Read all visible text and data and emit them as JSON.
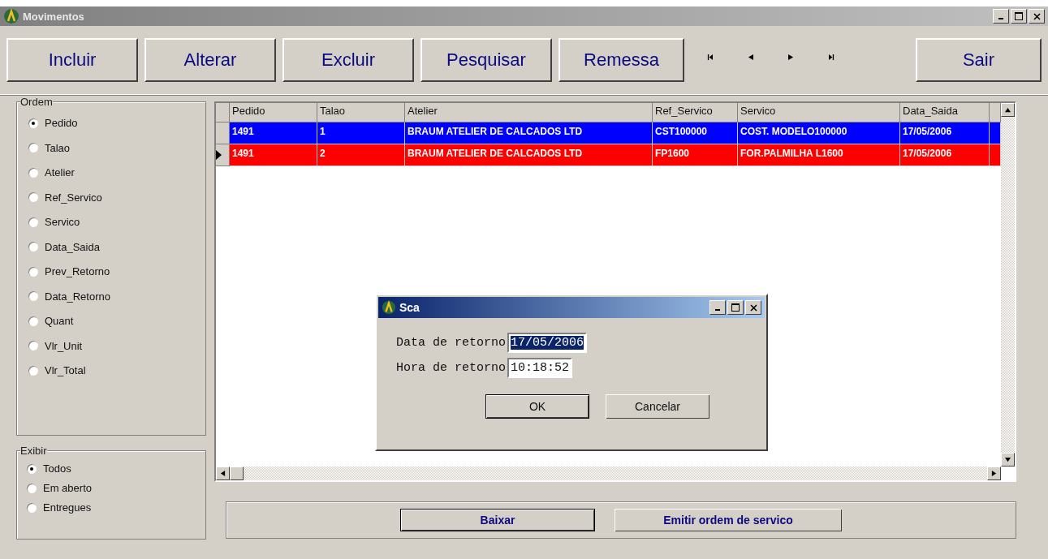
{
  "window": {
    "title": "Movimentos"
  },
  "toolbar": {
    "buttons": [
      {
        "label": "Incluir"
      },
      {
        "label": "Alterar"
      },
      {
        "label": "Excluir"
      },
      {
        "label": "Pesquisar"
      },
      {
        "label": "Remessa"
      }
    ],
    "navigation": [
      {
        "kind": "first"
      },
      {
        "kind": "prev"
      },
      {
        "kind": "next"
      },
      {
        "kind": "last"
      }
    ],
    "exit_button": {
      "label": "Sair"
    }
  },
  "ordem": {
    "title": "Ordem",
    "options": [
      {
        "label": "Pedido",
        "selected": true
      },
      {
        "label": "Talao",
        "selected": false
      },
      {
        "label": "Atelier",
        "selected": false
      },
      {
        "label": "Ref_Servico",
        "selected": false
      },
      {
        "label": "Servico",
        "selected": false
      },
      {
        "label": "Data_Saida",
        "selected": false
      },
      {
        "label": "Prev_Retorno",
        "selected": false
      },
      {
        "label": "Data_Retorno",
        "selected": false
      },
      {
        "label": "Quant",
        "selected": false
      },
      {
        "label": "Vlr_Unit",
        "selected": false
      },
      {
        "label": "Vlr_Total",
        "selected": false
      }
    ]
  },
  "exibir": {
    "title": "Exibir",
    "options": [
      {
        "label": "Todos",
        "selected": true
      },
      {
        "label": "Em aberto",
        "selected": false
      },
      {
        "label": "Entregues",
        "selected": false
      }
    ]
  },
  "table": {
    "columns": [
      "Pedido",
      "Talao",
      "Atelier",
      "Ref_Servico",
      "Servico",
      "Data_Saida"
    ],
    "rows": [
      {
        "cells": [
          "1491",
          "1",
          "BRAUM ATELIER DE CALCADOS LTD",
          "CST100000",
          "COST. MODELO100000",
          "17/05/2006"
        ],
        "color": "#0000ff",
        "current": false
      },
      {
        "cells": [
          "1491",
          "2",
          "BRAUM ATELIER DE CALCADOS LTD",
          "FP1600",
          "FOR.PALMILHA L1600",
          "17/05/2006"
        ],
        "color": "#ff0000",
        "current": true
      }
    ]
  },
  "bottom_buttons": [
    {
      "label": "Baixar",
      "selected": true
    },
    {
      "label": "Emitir ordem de servico",
      "selected": false
    }
  ],
  "dialog": {
    "title": "Sca",
    "fields": [
      {
        "label": "Data de retorno",
        "value": "17/05/2006",
        "selected": true
      },
      {
        "label": "Hora de retorno",
        "value": "10:18:52",
        "selected": false
      }
    ],
    "buttons": [
      {
        "label": "OK",
        "selected": true
      },
      {
        "label": "Cancelar",
        "selected": false
      }
    ]
  }
}
